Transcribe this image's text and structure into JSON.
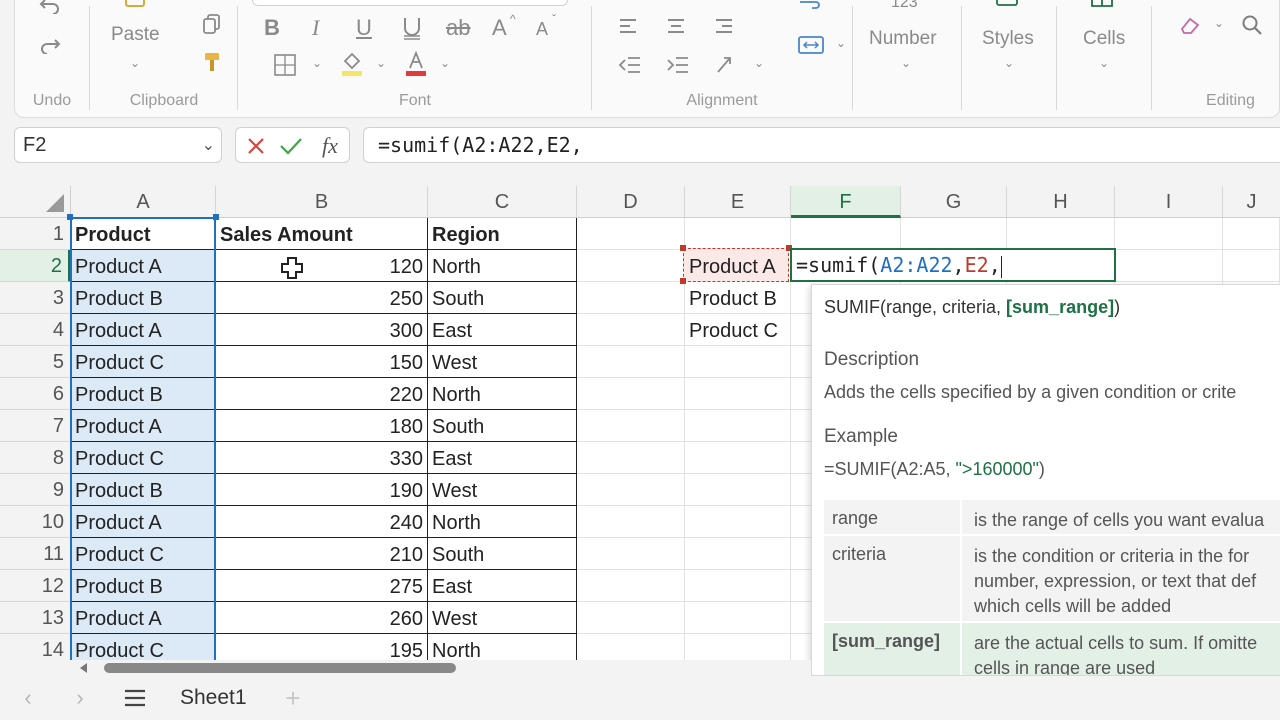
{
  "ribbon": {
    "undo": {
      "label": "Undo"
    },
    "clipboard": {
      "paste_label": "Paste",
      "group_label": "Clipboard"
    },
    "font": {
      "bold": "B",
      "italic": "I",
      "underline": "U",
      "strikethrough": "ab",
      "grow": "A",
      "shrink": "A",
      "group_label": "Font",
      "font_color": "#e03c3c",
      "fill_color": "#f5e663"
    },
    "alignment": {
      "group_label": "Alignment"
    },
    "number": {
      "label": "Number",
      "format_hint": "123"
    },
    "styles": {
      "label": "Styles"
    },
    "cells": {
      "label": "Cells"
    },
    "editing": {
      "group_label": "Editing"
    }
  },
  "formula_bar": {
    "name_box": "F2",
    "formula": "=sumif(A2:A22,E2,"
  },
  "grid": {
    "columns": [
      "A",
      "B",
      "C",
      "D",
      "E",
      "F",
      "G",
      "H",
      "I",
      "J"
    ],
    "rows": [
      "1",
      "2",
      "3",
      "4",
      "5",
      "6",
      "7",
      "8",
      "9",
      "10",
      "11",
      "12",
      "13",
      "14"
    ],
    "headers": {
      "a": "Product",
      "b": "Sales Amount",
      "c": "Region"
    },
    "data": [
      {
        "product": "Product A",
        "sales": "120",
        "region": "North"
      },
      {
        "product": "Product B",
        "sales": "250",
        "region": "South"
      },
      {
        "product": "Product A",
        "sales": "300",
        "region": "East"
      },
      {
        "product": "Product C",
        "sales": "150",
        "region": "West"
      },
      {
        "product": "Product B",
        "sales": "220",
        "region": "North"
      },
      {
        "product": "Product A",
        "sales": "180",
        "region": "South"
      },
      {
        "product": "Product C",
        "sales": "330",
        "region": "East"
      },
      {
        "product": "Product B",
        "sales": "190",
        "region": "West"
      },
      {
        "product": "Product A",
        "sales": "240",
        "region": "North"
      },
      {
        "product": "Product C",
        "sales": "210",
        "region": "South"
      },
      {
        "product": "Product B",
        "sales": "275",
        "region": "East"
      },
      {
        "product": "Product A",
        "sales": "260",
        "region": "West"
      },
      {
        "product": "Product C",
        "sales": "195",
        "region": "North"
      }
    ],
    "criteria_list": [
      "Product A",
      "Product B",
      "Product C"
    ],
    "editing_cell": {
      "prefix": "=sumif(",
      "range": "A2:A22",
      "sep1": ",",
      "criteria": "E2",
      "sep2": ","
    }
  },
  "tooltip": {
    "sig_name": "SUMIF(range, criteria, ",
    "sig_current": "[sum_range]",
    "sig_close": ")",
    "description_heading": "Description",
    "description": "Adds the cells specified by a given condition or crite",
    "example_heading": "Example",
    "example_prefix": "=SUMIF(A2:A5, ",
    "example_quote": "\">160000\"",
    "example_suffix": ")",
    "args": [
      {
        "name": "range",
        "desc1": "is the range of cells you want evalua",
        "desc2": "",
        "desc3": ""
      },
      {
        "name": "criteria",
        "desc1": "is the condition or criteria in the for",
        "desc2": "number, expression, or text that def",
        "desc3": "which cells will be added"
      },
      {
        "name": "[sum_range]",
        "desc1": "are the actual cells to sum. If omitte",
        "desc2": "cells in range are used",
        "desc3": ""
      }
    ]
  },
  "sheets": {
    "active": "Sheet1"
  },
  "colors": {
    "accent": "#1e7145",
    "range_blue": "#1f6fc5",
    "criteria_red": "#c0392b"
  }
}
